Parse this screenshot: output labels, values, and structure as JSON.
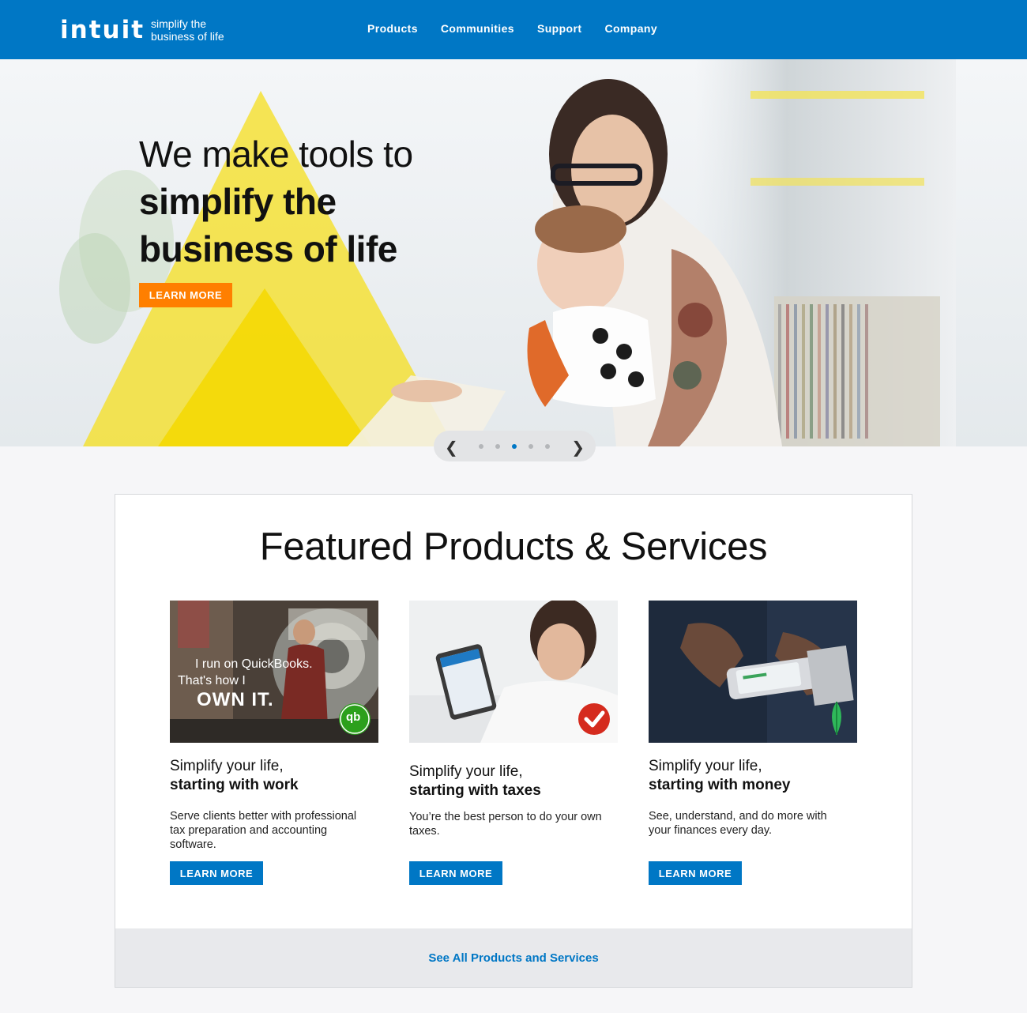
{
  "header": {
    "logo_word": "intuit",
    "logo_tagline": "simplify the business of life",
    "nav": [
      "Products",
      "Communities",
      "Support",
      "Company"
    ]
  },
  "hero": {
    "line1": "We make tools to",
    "line2": "simplify the",
    "line3": "business of life",
    "button": "LEARN MORE"
  },
  "carousel": {
    "prev_icon": "chevron-left-icon",
    "next_icon": "chevron-right-icon",
    "slide_count": 5,
    "active_index": 2
  },
  "featured": {
    "title": "Featured Products & Services",
    "cards": [
      {
        "h1": "Simplify your life,",
        "h2": "starting with work",
        "desc": "Serve clients better with professional tax preparation and accounting software.",
        "button": "LEARN MORE",
        "image_text1": "I run on QuickBooks.",
        "image_text2": "That's how I",
        "image_text3": "OWN IT.",
        "badge": "qb"
      },
      {
        "h1": "Simplify your life,",
        "h2": "starting with taxes",
        "desc": "You’re the best person to do your own taxes.",
        "button": "LEARN MORE"
      },
      {
        "h1": "Simplify your life,",
        "h2": "starting with money",
        "desc": "See, understand, and do more with your finances every day.",
        "button": "LEARN MORE"
      }
    ],
    "see_all": "See All Products and Services"
  },
  "colors": {
    "brand_blue": "#0077c5",
    "orange": "#ff7f00",
    "yellow": "#f5df1e"
  }
}
